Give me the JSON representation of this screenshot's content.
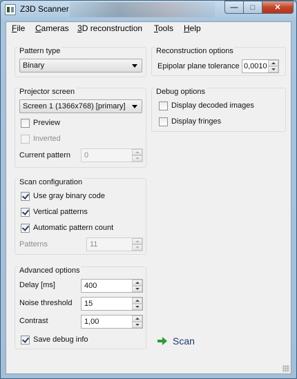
{
  "window": {
    "title": "Z3D Scanner"
  },
  "menu": [
    "File",
    "Cameras",
    "3D reconstruction",
    "Tools",
    "Help"
  ],
  "pattern_type": {
    "title": "Pattern type",
    "selected": "Binary"
  },
  "projector": {
    "title": "Projector screen",
    "screen": "Screen 1 (1366x768) [primary]",
    "preview_label": "Preview",
    "preview_checked": false,
    "inverted_label": "Inverted",
    "inverted_checked": false,
    "current_pattern_label": "Current pattern",
    "current_pattern_value": "0"
  },
  "scan_config": {
    "title": "Scan configuration",
    "gray_label": "Use gray binary code",
    "gray_checked": true,
    "vertical_label": "Vertical patterns",
    "vertical_checked": true,
    "auto_label": "Automatic pattern count",
    "auto_checked": true,
    "patterns_label": "Patterns",
    "patterns_value": "11"
  },
  "advanced": {
    "title": "Advanced options",
    "delay_label": "Delay [ms]",
    "delay_value": "400",
    "noise_label": "Noise threshold",
    "noise_value": "15",
    "contrast_label": "Contrast",
    "contrast_value": "1,00",
    "debug_label": "Save debug info",
    "debug_checked": true
  },
  "reconstruction": {
    "title": "Reconstruction options",
    "epipolar_label": "Epipolar plane tolerance",
    "epipolar_value": "0,0010"
  },
  "debug": {
    "title": "Debug options",
    "decoded_label": "Display decoded images",
    "decoded_checked": false,
    "fringes_label": "Display fringes",
    "fringes_checked": false
  },
  "scan_button": {
    "label": "Scan",
    "icon": "arrow-right-icon"
  }
}
